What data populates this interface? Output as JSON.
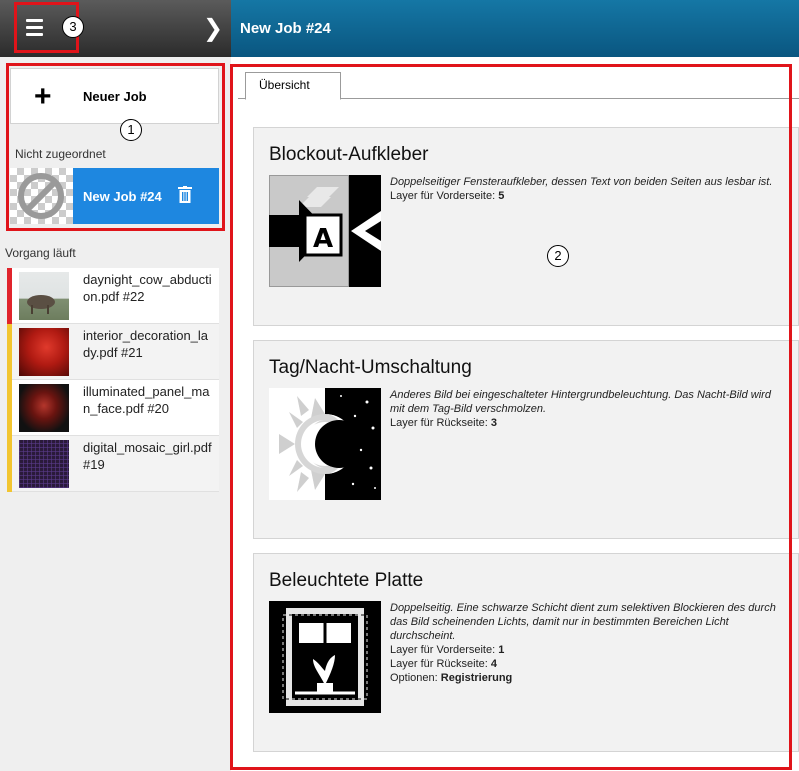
{
  "header": {
    "job_title": "New Job #24"
  },
  "sidebar": {
    "new_job_label": "Neuer Job",
    "unassigned_label": "Nicht zugeordnet",
    "selected_job_label": "New Job #24",
    "in_progress_label": "Vorgang läuft",
    "running_jobs": [
      {
        "name": "daynight_cow_abduction.pdf #22",
        "status_color": "#e0242c"
      },
      {
        "name": "interior_decoration_lady.pdf #21",
        "status_color": "#f2c530"
      },
      {
        "name": "illuminated_panel_man_face.pdf #20",
        "status_color": "#f2c530"
      },
      {
        "name": "digital_mosaic_girl.pdf #19",
        "status_color": "#f2c530"
      }
    ]
  },
  "main": {
    "tab_label": "Übersicht",
    "cards": [
      {
        "title": "Blockout-Aufkleber",
        "desc": "Doppelseitiger Fensteraufkleber, dessen Text von beiden Seiten aus lesbar ist.",
        "line1_label": "Layer für Vorderseite:",
        "line1_value": "5",
        "icon": "blockout-sticker-icon"
      },
      {
        "title": "Tag/Nacht-Umschaltung",
        "desc": "Anderes Bild bei eingeschalteter Hintergrundbeleuchtung. Das Nacht-Bild wird mit dem Tag-Bild verschmolzen.",
        "line1_label": "Layer für Rückseite:",
        "line1_value": "3",
        "icon": "day-night-icon"
      },
      {
        "title": "Beleuchtete Platte",
        "desc": "Doppelseitig. Eine schwarze Schicht dient zum selektiven Blockieren des durch das Bild scheinenden Lichts, damit nur in bestimmten Bereichen Licht durchscheint.",
        "line1_label": "Layer für Vorderseite:",
        "line1_value": "1",
        "line2_label": "Layer für Rückseite:",
        "line2_value": "4",
        "line3_label": "Optionen:",
        "line3_value": "Registrierung",
        "icon": "illuminated-panel-icon"
      }
    ]
  },
  "annotations": [
    "1",
    "2",
    "3"
  ],
  "colors": {
    "accent": "#1e87e0",
    "header": "#0e6792",
    "annotation": "#e0141a"
  }
}
